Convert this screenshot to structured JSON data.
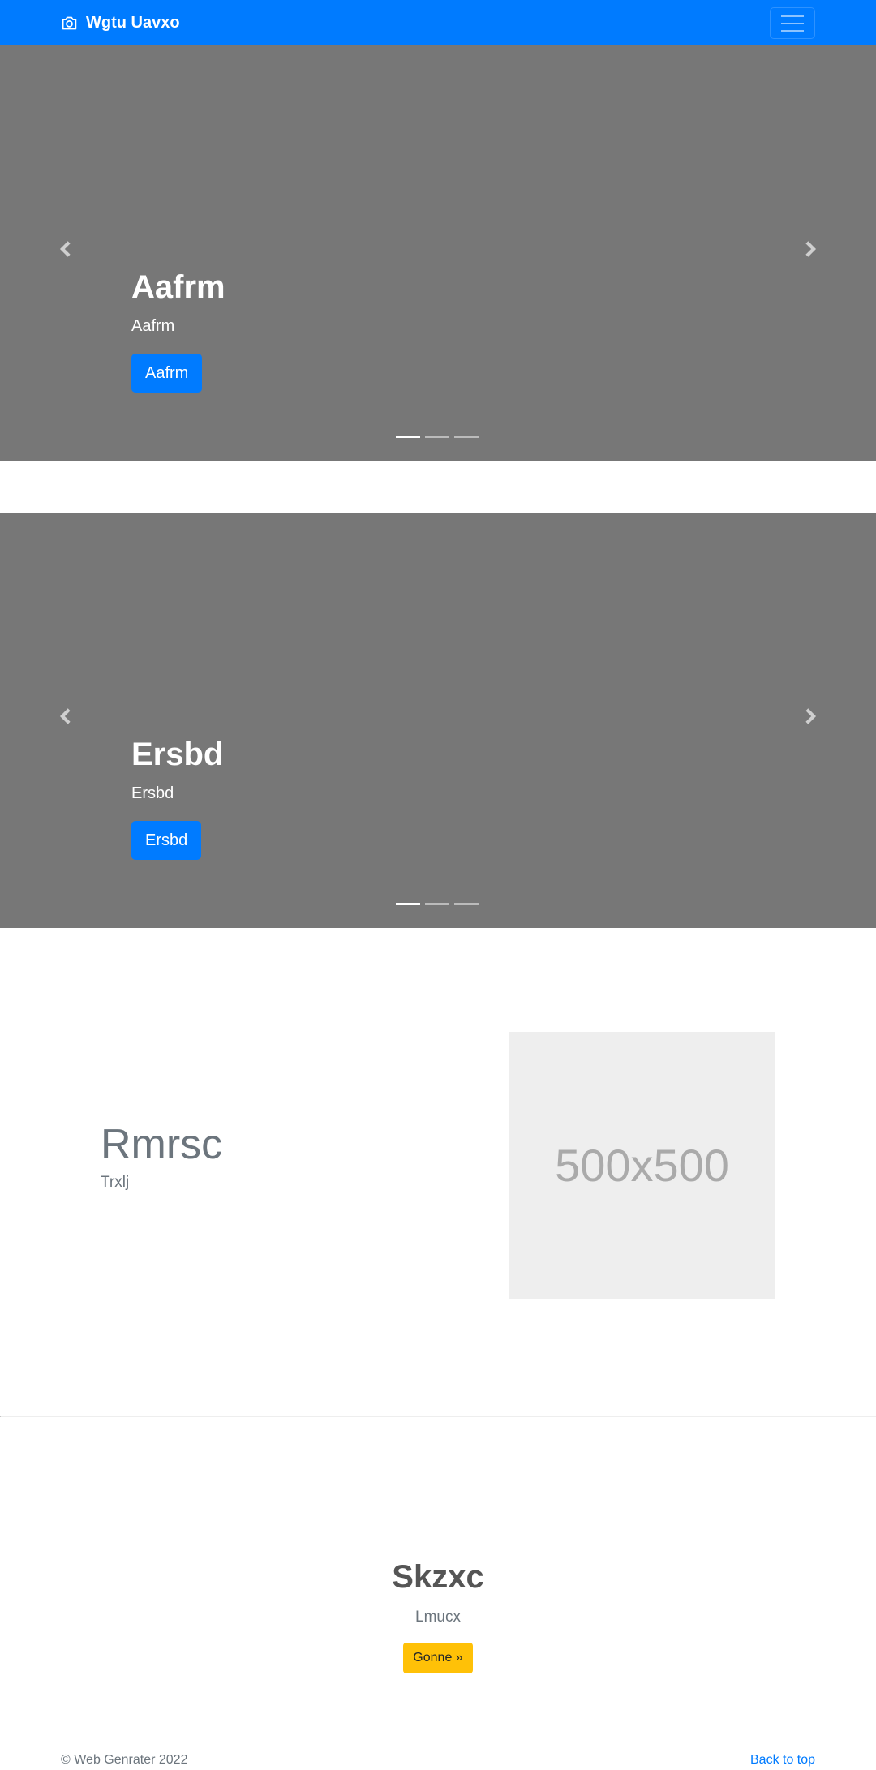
{
  "navbar": {
    "brand_text": "Wgtu Uavxo",
    "brand_icon": "camera-icon",
    "toggler_icon": "hamburger-icon",
    "background": "#007bff"
  },
  "carousels": [
    {
      "title": "Aafrm",
      "subtitle": "Aafrm",
      "button_label": "Aafrm",
      "slide_count": 3,
      "active_slide": 1
    },
    {
      "title": "Ersbd",
      "subtitle": "Ersbd",
      "button_label": "Ersbd",
      "slide_count": 3,
      "active_slide": 1
    }
  ],
  "feature": {
    "title": "Rmrsc",
    "subtitle": "Trxlj",
    "image_label": "500x500"
  },
  "jumbotron": {
    "title": "Skzxc",
    "subtitle": "Lmucx",
    "button_label": "Gonne »",
    "button_color": "#ffc107"
  },
  "footer": {
    "copyright": "© Web Genrater 2022",
    "back_to_top": "Back to top"
  }
}
